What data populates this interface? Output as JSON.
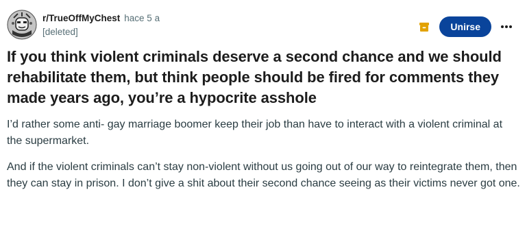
{
  "post": {
    "subreddit": "r/TrueOffMyChest",
    "time_ago": "hace 5 a",
    "author": "[deleted]",
    "join_label": "Unirse",
    "more_icon": "more-horizontal-icon",
    "badge_icon": "archived-box-icon",
    "title": "If you think violent criminals deserve a second chance and we should rehabilitate them, but think people should be fired for comments they made years ago, you’re a hypocrite asshole",
    "paragraphs": [
      "I’d rather some anti- gay marriage boomer keep their job than have to interact with a violent criminal at the supermarket.",
      "And if the violent criminals can’t stay non-violent without us going out of our way to reintegrate them, then they can stay in prison. I don’t give a shit about their second chance seeing as their victims never got one."
    ]
  },
  "colors": {
    "join_button": "#0a449b",
    "badge": "#e2a200",
    "meta_text": "#576f76",
    "body_text": "#2a3c42"
  }
}
